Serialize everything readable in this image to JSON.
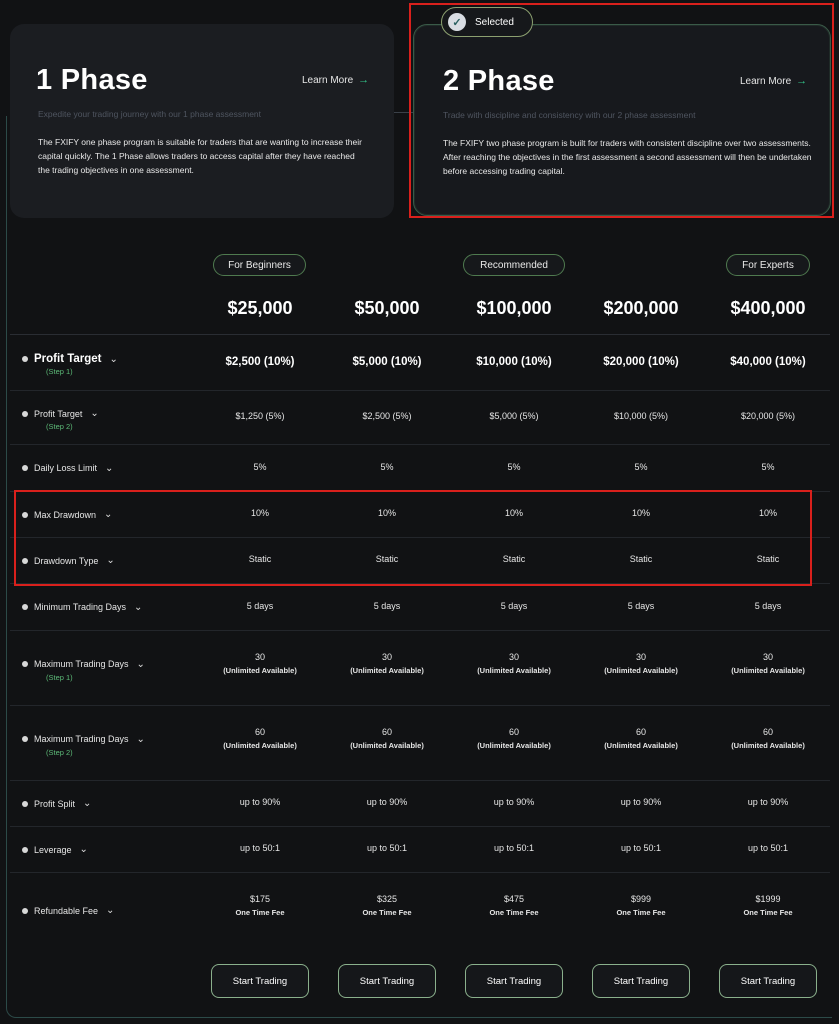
{
  "phase1": {
    "title": "1 Phase",
    "learn_more": "Learn More",
    "subtitle": "Expedite your trading journey with our 1 phase assessment",
    "description": "The FXIFY one phase program is suitable for traders that are wanting to increase their capital quickly. The 1 Phase allows traders to access capital after they have reached the trading objectives in one assessment."
  },
  "phase2": {
    "selected_label": "Selected",
    "title": "2 Phase",
    "learn_more": "Learn More",
    "subtitle": "Trade with discipline and consistency with our 2 phase assessment",
    "description": "The FXIFY two phase program is built for traders with consistent discipline over two assessments. After reaching the objectives in the first assessment a second assessment will then be undertaken before accessing trading capital."
  },
  "badges": [
    "For Beginners",
    "Recommended",
    "For Experts"
  ],
  "account_sizes": [
    "$25,000",
    "$50,000",
    "$100,000",
    "$200,000",
    "$400,000"
  ],
  "rows": [
    {
      "label": "Profit Target",
      "step": "(Step 1)",
      "values": [
        "$2,500 (10%)",
        "$5,000 (10%)",
        "$10,000 (10%)",
        "$20,000 (10%)",
        "$40,000 (10%)"
      ]
    },
    {
      "label": "Profit Target",
      "step": "(Step 2)",
      "values": [
        "$1,250 (5%)",
        "$2,500 (5%)",
        "$5,000 (5%)",
        "$10,000 (5%)",
        "$20,000 (5%)"
      ]
    },
    {
      "label": "Daily Loss Limit",
      "values": [
        "5%",
        "5%",
        "5%",
        "5%",
        "5%"
      ]
    },
    {
      "label": "Max Drawdown",
      "values": [
        "10%",
        "10%",
        "10%",
        "10%",
        "10%"
      ]
    },
    {
      "label": "Drawdown Type",
      "values": [
        "Static",
        "Static",
        "Static",
        "Static",
        "Static"
      ]
    },
    {
      "label": "Minimum Trading Days",
      "values": [
        "5 days",
        "5 days",
        "5 days",
        "5 days",
        "5 days"
      ]
    },
    {
      "label": "Maximum Trading Days",
      "step": "(Step 1)",
      "values": [
        "30",
        "30",
        "30",
        "30",
        "30"
      ],
      "sub": "(Unlimited Available)"
    },
    {
      "label": "Maximum Trading Days",
      "step": "(Step 2)",
      "values": [
        "60",
        "60",
        "60",
        "60",
        "60"
      ],
      "sub": "(Unlimited Available)"
    },
    {
      "label": "Profit Split",
      "values": [
        "up to 90%",
        "up to 90%",
        "up to 90%",
        "up to 90%",
        "up to 90%"
      ]
    },
    {
      "label": "Leverage",
      "values": [
        "up to 50:1",
        "up to 50:1",
        "up to 50:1",
        "up to 50:1",
        "up to 50:1"
      ]
    },
    {
      "label": "Refundable Fee",
      "values": [
        "$175",
        "$325",
        "$475",
        "$999",
        "$1999"
      ],
      "sub": "One Time Fee"
    }
  ],
  "cta_label": "Start Trading"
}
